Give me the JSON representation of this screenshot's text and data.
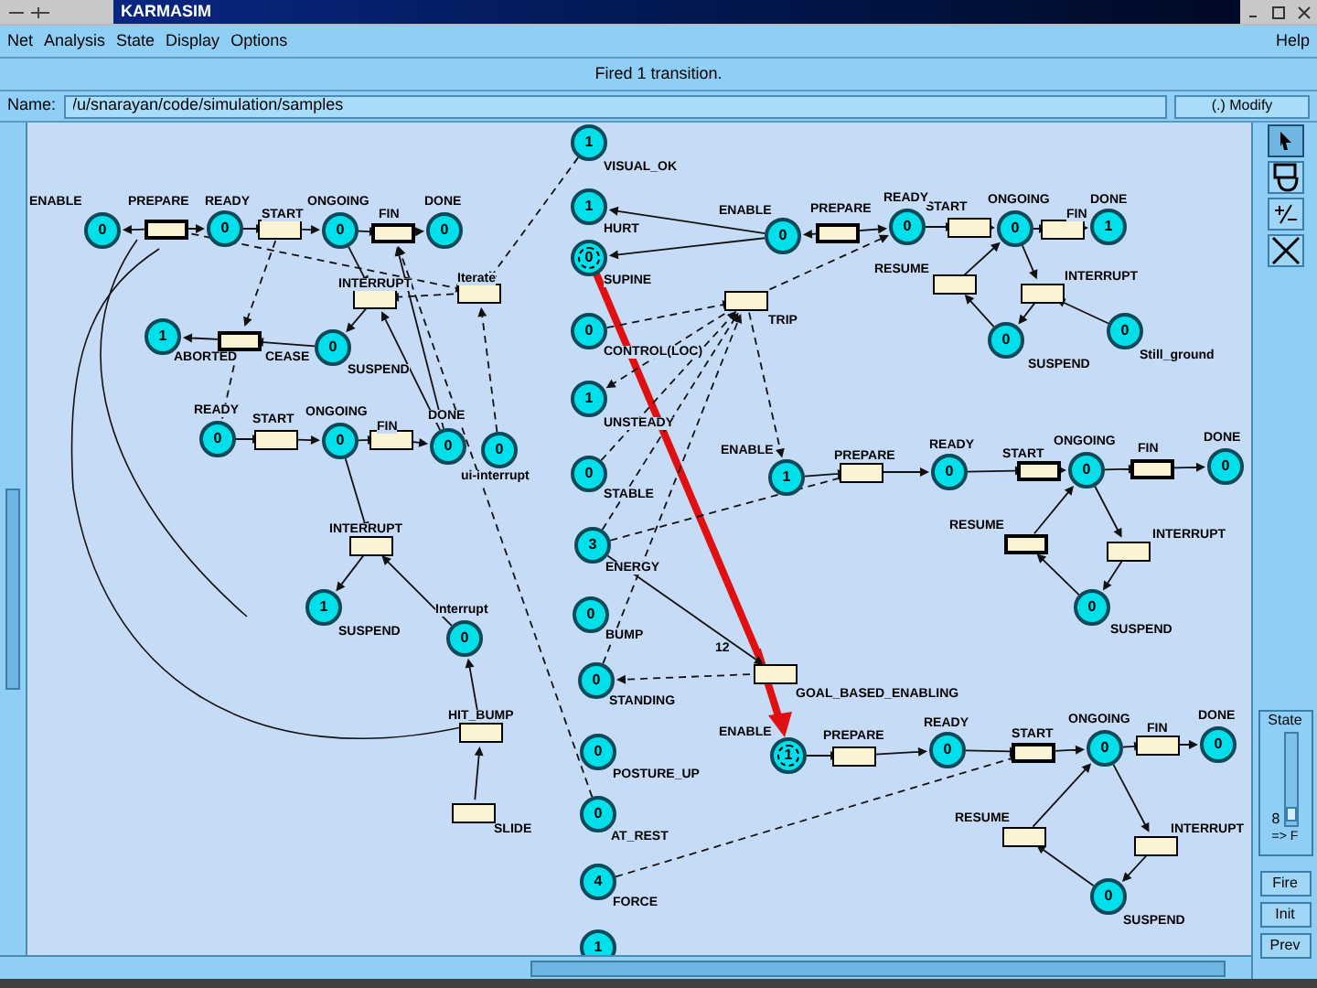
{
  "window": {
    "title": "KARMASIM"
  },
  "menu": [
    {
      "label": "Net"
    },
    {
      "label": "Analysis"
    },
    {
      "label": "State"
    },
    {
      "label": "Display"
    },
    {
      "label": "Options"
    }
  ],
  "help_menu": {
    "label": "Help"
  },
  "status": "Fired 1 transition.",
  "name_field": {
    "label": "Name:",
    "value": "/u/snarayan/code/simulation/samples"
  },
  "mode": "(.) Modify",
  "net": {
    "places": [
      {
        "label": "ENABLE",
        "tokens": "0",
        "highlighted": false
      },
      {
        "label": "READY",
        "tokens": "0",
        "highlighted": false
      },
      {
        "label": "ONGOING",
        "tokens": "0",
        "highlighted": false
      },
      {
        "label": "DONE",
        "tokens": "0",
        "highlighted": false
      },
      {
        "label": "ABORTED",
        "tokens": "1",
        "highlighted": false
      },
      {
        "label": "SUSPEND",
        "tokens": "0",
        "highlighted": false
      },
      {
        "label": "READY",
        "tokens": "0",
        "highlighted": false
      },
      {
        "label": "ONGOING",
        "tokens": "0",
        "highlighted": false
      },
      {
        "label": "DONE",
        "tokens": "0",
        "highlighted": false
      },
      {
        "label": "ui-interrupt",
        "tokens": "0",
        "highlighted": false
      },
      {
        "label": "SUSPEND",
        "tokens": "1",
        "highlighted": false
      },
      {
        "label": "Interrupt",
        "tokens": "0",
        "highlighted": false
      },
      {
        "label": "VISUAL_OK",
        "tokens": "1",
        "highlighted": false
      },
      {
        "label": "HURT",
        "tokens": "1",
        "highlighted": false
      },
      {
        "label": "SUPINE",
        "tokens": "0",
        "highlighted": true
      },
      {
        "label": "CONTROL(LOC)",
        "tokens": "0",
        "highlighted": false
      },
      {
        "label": "UNSTEADY",
        "tokens": "1",
        "highlighted": false
      },
      {
        "label": "STABLE",
        "tokens": "0",
        "highlighted": false
      },
      {
        "label": "ENERGY",
        "tokens": "3",
        "highlighted": false
      },
      {
        "label": "BUMP",
        "tokens": "0",
        "highlighted": false
      },
      {
        "label": "STANDING",
        "tokens": "0",
        "highlighted": false
      },
      {
        "label": "POSTURE_UP",
        "tokens": "0",
        "highlighted": false
      },
      {
        "label": "AT_REST",
        "tokens": "0",
        "highlighted": false
      },
      {
        "label": "FORCE",
        "tokens": "4",
        "highlighted": false
      },
      {
        "tokens": "1",
        "highlighted": false
      },
      {
        "label": "ENABLE",
        "tokens": "0",
        "highlighted": false
      },
      {
        "label": "READY",
        "tokens": "0",
        "highlighted": false
      },
      {
        "label": "ONGOING",
        "tokens": "0",
        "highlighted": false
      },
      {
        "label": "DONE",
        "tokens": "1",
        "highlighted": false
      },
      {
        "label": "SUSPEND",
        "tokens": "0",
        "highlighted": false
      },
      {
        "label": "Still_ground",
        "tokens": "0",
        "highlighted": false
      },
      {
        "label": "ENABLE",
        "tokens": "1",
        "highlighted": false
      },
      {
        "label": "READY",
        "tokens": "0",
        "highlighted": false
      },
      {
        "label": "ONGOING",
        "tokens": "0",
        "highlighted": false
      },
      {
        "label": "DONE",
        "tokens": "0",
        "highlighted": false
      },
      {
        "label": "SUSPEND",
        "tokens": "0",
        "highlighted": false
      },
      {
        "label": "ENABLE",
        "tokens": "1",
        "highlighted": true
      },
      {
        "label": "READY",
        "tokens": "0",
        "highlighted": false
      },
      {
        "label": "ONGOING",
        "tokens": "0",
        "highlighted": false
      },
      {
        "label": "DONE",
        "tokens": "0",
        "highlighted": false
      },
      {
        "label": "SUSPEND",
        "tokens": "0",
        "highlighted": false
      }
    ],
    "transitions": [
      {
        "label": "PREPARE",
        "enabled": true
      },
      {
        "label": "START",
        "enabled": false
      },
      {
        "label": "FIN",
        "enabled": true
      },
      {
        "label": "INTERRUPT",
        "enabled": false
      },
      {
        "label": "Iterate",
        "enabled": false
      },
      {
        "label": "CEASE",
        "enabled": true
      },
      {
        "label": "START",
        "enabled": false
      },
      {
        "label": "FIN",
        "enabled": false
      },
      {
        "label": "INTERRUPT",
        "enabled": false
      },
      {
        "label": "HIT_BUMP",
        "enabled": false
      },
      {
        "label": "SLIDE",
        "enabled": false
      },
      {
        "label": "TRIP",
        "enabled": false
      },
      {
        "label": "PREPARE",
        "enabled": true
      },
      {
        "label": "START",
        "enabled": false
      },
      {
        "label": "FIN",
        "enabled": false
      },
      {
        "label": "RESUME",
        "enabled": false
      },
      {
        "label": "INTERRUPT",
        "enabled": false
      },
      {
        "label": "PREPARE",
        "enabled": false
      },
      {
        "label": "START",
        "enabled": true
      },
      {
        "label": "FIN",
        "enabled": true
      },
      {
        "label": "RESUME",
        "enabled": true
      },
      {
        "label": "INTERRUPT",
        "enabled": false
      },
      {
        "label": "GOAL_BASED_ENABLING",
        "enabled": false
      },
      {
        "label": "PREPARE",
        "enabled": false
      },
      {
        "label": "START",
        "enabled": true
      },
      {
        "label": "FIN",
        "enabled": false
      },
      {
        "label": "RESUME",
        "enabled": false
      },
      {
        "label": "INTERRUPT",
        "enabled": false
      }
    ],
    "arc_weights": [
      "12"
    ]
  },
  "tools": [
    {
      "kind": "pointer",
      "selected": true
    },
    {
      "kind": "shape",
      "selected": false
    },
    {
      "kind": "plusminus",
      "selected": false
    },
    {
      "kind": "delete",
      "selected": false
    }
  ],
  "state_panel": {
    "title": "State",
    "level": 0.05,
    "value": "8",
    "mode": "=> F"
  },
  "buttons": [
    "Fire",
    "Init",
    "Prev"
  ]
}
